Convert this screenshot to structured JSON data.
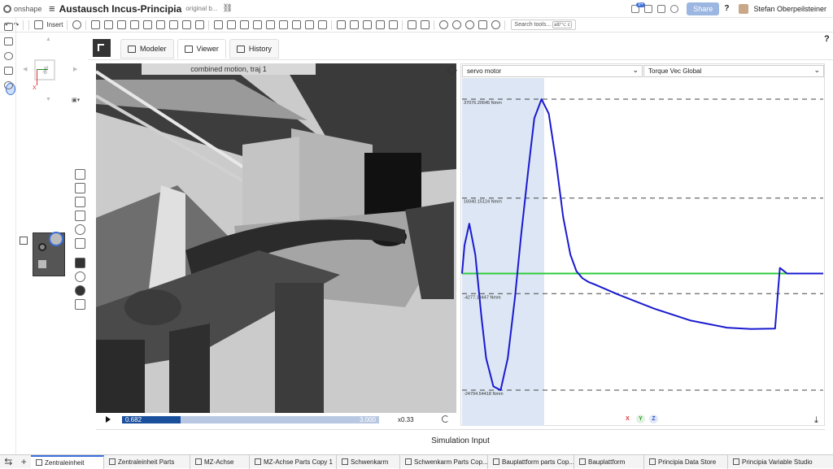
{
  "app": {
    "brand": "onshape",
    "document_title": "Austausch Incus-Principia",
    "document_subtitle": "original b...",
    "share_label": "Share",
    "user_name": "Stefan Oberpeilsteiner",
    "notifications_count": "9+",
    "help_label": "?"
  },
  "toolbar": {
    "insert_label": "Insert",
    "search_placeholder": "Search tools...",
    "search_shortcut": "alt/⌥ c"
  },
  "viewcube": {
    "face_label": "Top",
    "axis_x": "X"
  },
  "app_tabs": [
    {
      "label": "Modeler",
      "active": false
    },
    {
      "label": "Viewer",
      "active": true
    },
    {
      "label": "History",
      "active": false
    }
  ],
  "viewport": {
    "banner": "combined motion, traj 1"
  },
  "playback": {
    "current": "0.682",
    "end": "3.000",
    "progress_fraction": 0.227,
    "speed": "x0.33"
  },
  "plot": {
    "select_left": "servo motor",
    "select_right": "Torque Vec Global",
    "xyz_buttons": [
      "X",
      "Y",
      "Z"
    ],
    "xyz_colors": [
      "#d33",
      "#2a9a2a",
      "#2a55c8"
    ]
  },
  "chart_data": {
    "type": "line",
    "title": "",
    "xlabel": "",
    "ylabel": "",
    "ylim": [
      -24794.54418,
      37076.20645
    ],
    "xlim": [
      0,
      3.0
    ],
    "highlight_x_range": [
      0,
      0.682
    ],
    "reference_lines": [
      {
        "value": 37076.20645,
        "label": "37076.20645 Nmm"
      },
      {
        "value": 16040.15124,
        "label": "16040.15124 Nmm"
      },
      {
        "value": -4277.18447,
        "label": "-4277.18447 Nmm"
      },
      {
        "value": -24794.54418,
        "label": "-24794.54418 Nmm"
      }
    ],
    "series": [
      {
        "name": "",
        "color": "#1a1ad0",
        "x": [
          0.0,
          0.02,
          0.06,
          0.11,
          0.16,
          0.2,
          0.26,
          0.32,
          0.38,
          0.44,
          0.49,
          0.55,
          0.6,
          0.66,
          0.72,
          0.78,
          0.84,
          0.9,
          0.95,
          1.0,
          1.05,
          1.1,
          1.3,
          1.6,
          1.9,
          2.2,
          2.4,
          2.6,
          2.64,
          2.66,
          2.7,
          2.78,
          2.9,
          3.0
        ],
        "values": [
          0,
          6000,
          10600,
          4000,
          -9000,
          -18000,
          -24000,
          -24794,
          -18000,
          -5000,
          8000,
          22000,
          33000,
          37076,
          34000,
          24000,
          12000,
          4000,
          500,
          -1000,
          -1800,
          -2300,
          -4500,
          -7500,
          -10000,
          -11500,
          -11800,
          -11700,
          1200,
          800,
          0,
          0,
          0,
          0
        ]
      },
      {
        "name": "",
        "color": "#2ecc3a",
        "x": [
          0.0,
          3.0
        ],
        "values": [
          0,
          0
        ]
      }
    ]
  },
  "sim_input_label": "Simulation Input",
  "bottom_tabs": [
    {
      "label": "Zentraleinheit",
      "active": true
    },
    {
      "label": "Zentraleinheit Parts",
      "active": false
    },
    {
      "label": "MZ-Achse",
      "active": false
    },
    {
      "label": "MZ-Achse Parts Copy 1",
      "active": false
    },
    {
      "label": "Schwenkarm",
      "active": false
    },
    {
      "label": "Schwenkarm Parts Cop...",
      "active": false
    },
    {
      "label": "Bauplattform parts Cop...",
      "active": false
    },
    {
      "label": "Bauplattform",
      "active": false
    },
    {
      "label": "Principia Data Store",
      "active": false
    },
    {
      "label": "Principia Variable Studio",
      "active": false
    }
  ]
}
